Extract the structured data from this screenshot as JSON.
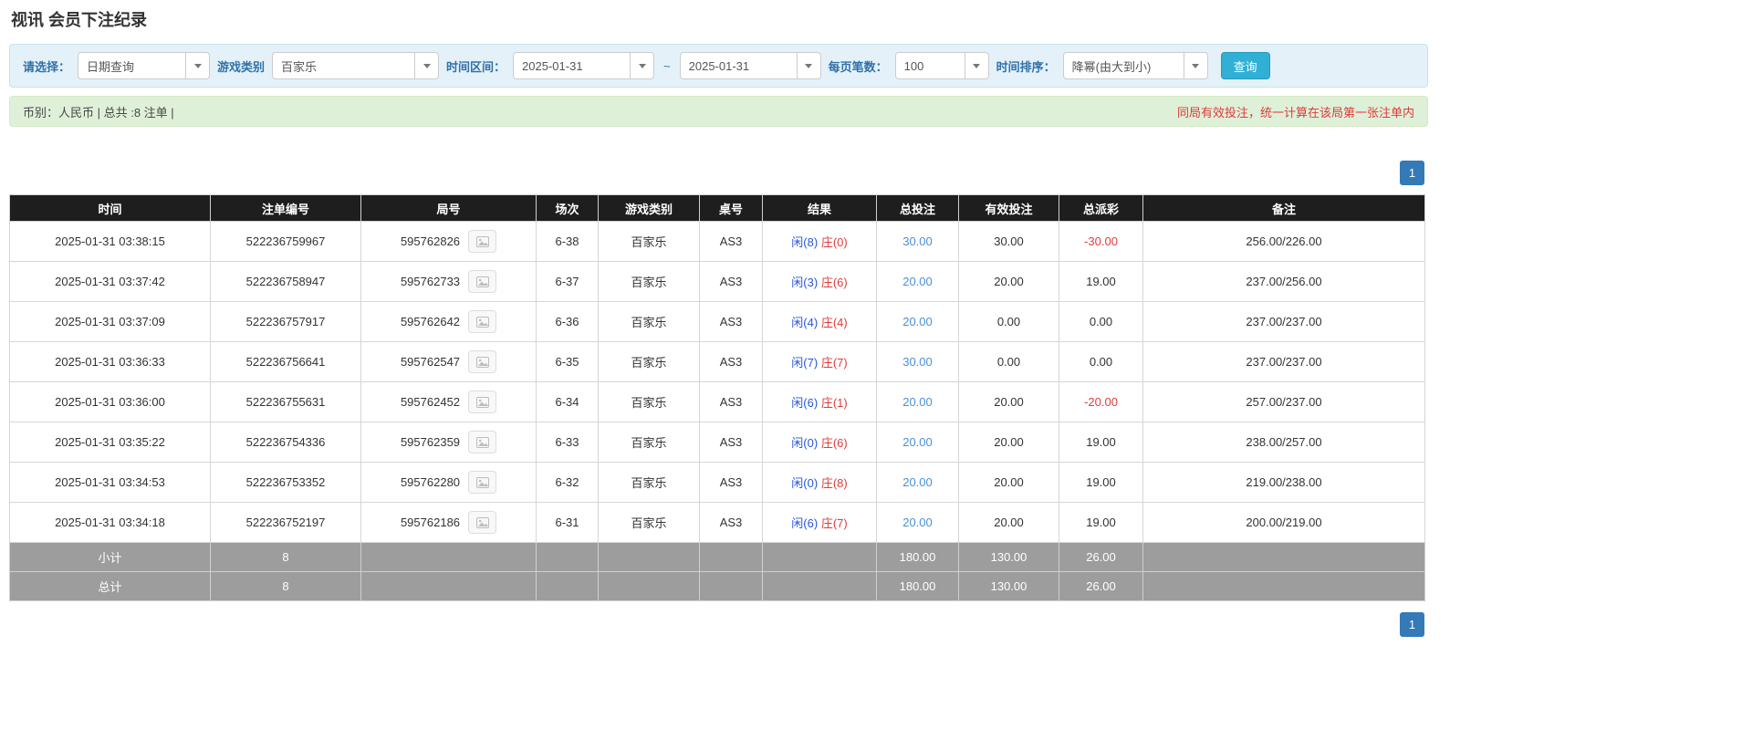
{
  "page": {
    "title": "视讯 会员下注纪录"
  },
  "filters": {
    "select_label": "请选择：",
    "select_value": "日期查询",
    "game_type_label": "游戏类别",
    "game_type_value": "百家乐",
    "time_range_label": "时间区间：",
    "date_from": "2025-01-31",
    "tilde": "~",
    "date_to": "2025-01-31",
    "page_size_label": "每页笔数：",
    "page_size_value": "100",
    "sort_label": "时间排序：",
    "sort_value": "降幂(由大到小)",
    "search_button": "查询"
  },
  "summary": {
    "left": "币别：人民币 | 总共 :8 注单 |",
    "right": "同局有效投注，统一计算在该局第一张注单内"
  },
  "pagination": {
    "page": "1"
  },
  "icons": {
    "combo_caret": "caret-down-icon",
    "round_button": "image-icon"
  },
  "colors": {
    "accent_blue": "#337ab7",
    "search_button": "#31b0d5",
    "player_blue": "#2757d6",
    "banker_red": "#e03c3c",
    "negative_red": "#e03c3c",
    "header_bg": "#1e1e1e",
    "footer_bg": "#9d9d9d",
    "filter_bar_bg": "#e4f1f9",
    "summary_bar_bg": "#dff0d8"
  },
  "table": {
    "headers": [
      "时间",
      "注单编号",
      "局号",
      "场次",
      "游戏类别",
      "桌号",
      "结果",
      "总投注",
      "有效投注",
      "总派彩",
      "备注"
    ],
    "rows": [
      {
        "time": "2025-01-31 03:38:15",
        "bet_id": "522236759967",
        "round_id": "595762826",
        "session": "6-38",
        "game_type": "百家乐",
        "table_no": "AS3",
        "result_player": "闲(8)",
        "result_banker": "庄(0)",
        "total_bet": "30.00",
        "valid_bet": "30.00",
        "payout": "-30.00",
        "note": "256.00/226.00"
      },
      {
        "time": "2025-01-31 03:37:42",
        "bet_id": "522236758947",
        "round_id": "595762733",
        "session": "6-37",
        "game_type": "百家乐",
        "table_no": "AS3",
        "result_player": "闲(3)",
        "result_banker": "庄(6)",
        "total_bet": "20.00",
        "valid_bet": "20.00",
        "payout": "19.00",
        "note": "237.00/256.00"
      },
      {
        "time": "2025-01-31 03:37:09",
        "bet_id": "522236757917",
        "round_id": "595762642",
        "session": "6-36",
        "game_type": "百家乐",
        "table_no": "AS3",
        "result_player": "闲(4)",
        "result_banker": "庄(4)",
        "total_bet": "20.00",
        "valid_bet": "0.00",
        "payout": "0.00",
        "note": "237.00/237.00"
      },
      {
        "time": "2025-01-31 03:36:33",
        "bet_id": "522236756641",
        "round_id": "595762547",
        "session": "6-35",
        "game_type": "百家乐",
        "table_no": "AS3",
        "result_player": "闲(7)",
        "result_banker": "庄(7)",
        "total_bet": "30.00",
        "valid_bet": "0.00",
        "payout": "0.00",
        "note": "237.00/237.00"
      },
      {
        "time": "2025-01-31 03:36:00",
        "bet_id": "522236755631",
        "round_id": "595762452",
        "session": "6-34",
        "game_type": "百家乐",
        "table_no": "AS3",
        "result_player": "闲(6)",
        "result_banker": "庄(1)",
        "total_bet": "20.00",
        "valid_bet": "20.00",
        "payout": "-20.00",
        "note": "257.00/237.00"
      },
      {
        "time": "2025-01-31 03:35:22",
        "bet_id": "522236754336",
        "round_id": "595762359",
        "session": "6-33",
        "game_type": "百家乐",
        "table_no": "AS3",
        "result_player": "闲(0)",
        "result_banker": "庄(6)",
        "total_bet": "20.00",
        "valid_bet": "20.00",
        "payout": "19.00",
        "note": "238.00/257.00"
      },
      {
        "time": "2025-01-31 03:34:53",
        "bet_id": "522236753352",
        "round_id": "595762280",
        "session": "6-32",
        "game_type": "百家乐",
        "table_no": "AS3",
        "result_player": "闲(0)",
        "result_banker": "庄(8)",
        "total_bet": "20.00",
        "valid_bet": "20.00",
        "payout": "19.00",
        "note": "219.00/238.00"
      },
      {
        "time": "2025-01-31 03:34:18",
        "bet_id": "522236752197",
        "round_id": "595762186",
        "session": "6-31",
        "game_type": "百家乐",
        "table_no": "AS3",
        "result_player": "闲(6)",
        "result_banker": "庄(7)",
        "total_bet": "20.00",
        "valid_bet": "20.00",
        "payout": "19.00",
        "note": "200.00/219.00"
      }
    ],
    "footer": [
      {
        "label": "小计",
        "count": "8",
        "total_bet": "180.00",
        "valid_bet": "130.00",
        "payout": "26.00"
      },
      {
        "label": "总计",
        "count": "8",
        "total_bet": "180.00",
        "valid_bet": "130.00",
        "payout": "26.00"
      }
    ]
  }
}
